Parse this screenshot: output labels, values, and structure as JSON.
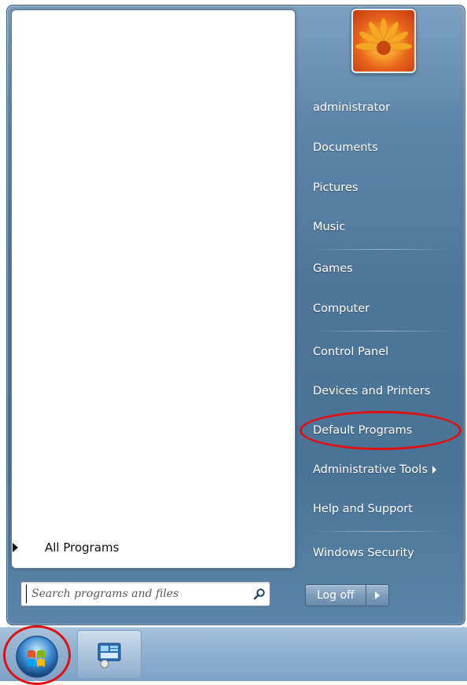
{
  "left_pane": {
    "all_programs_label": "All Programs",
    "search_placeholder": "Search programs and files"
  },
  "user": {
    "name": "administrator"
  },
  "right_pane": {
    "items": [
      {
        "label": "Documents"
      },
      {
        "label": "Pictures"
      },
      {
        "label": "Music"
      },
      {
        "label": "Games"
      },
      {
        "label": "Computer"
      },
      {
        "label": "Control Panel"
      },
      {
        "label": "Devices and Printers"
      },
      {
        "label": "Default Programs"
      },
      {
        "label": "Administrative Tools"
      },
      {
        "label": "Help and Support"
      },
      {
        "label": "Windows Security"
      }
    ]
  },
  "shutdown": {
    "logoff_label": "Log off"
  },
  "colors": {
    "highlight_ring": "#e01010",
    "menu_right_pane": "#4f7699"
  },
  "icons": {
    "search": "search-icon",
    "start": "windows-logo-icon",
    "taskbar_app": "control-panel-icon"
  }
}
